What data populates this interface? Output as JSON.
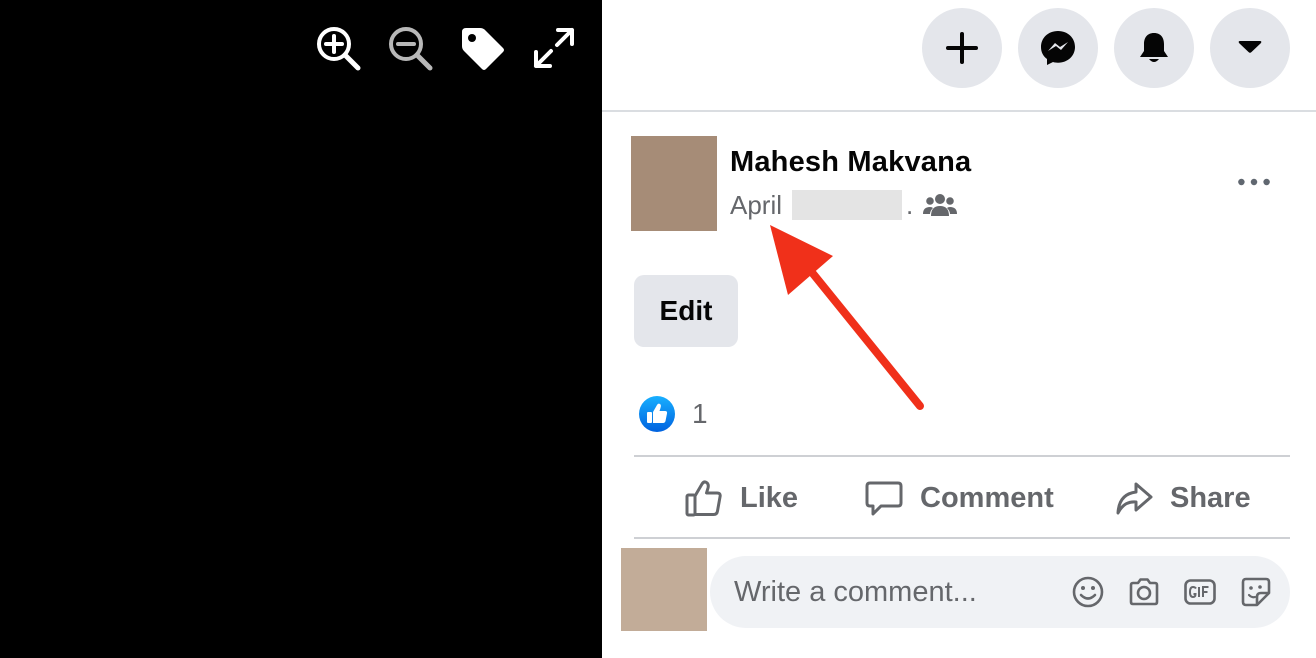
{
  "viewer": {
    "tools": [
      {
        "icon": "zoom-in-icon"
      },
      {
        "icon": "zoom-out-icon"
      },
      {
        "icon": "tag-icon"
      },
      {
        "icon": "fullscreen-icon"
      }
    ]
  },
  "topbar": {
    "buttons": [
      {
        "icon": "plus-icon"
      },
      {
        "icon": "messenger-icon"
      },
      {
        "icon": "bell-icon"
      },
      {
        "icon": "caret-down-icon"
      }
    ]
  },
  "post": {
    "author": "Mahesh Makvana",
    "date_label": "April",
    "separator": ".",
    "audience_icon": "friends-icon",
    "more_icon": "more-horizontal-icon",
    "edit_label": "Edit",
    "reaction_count": "1",
    "reaction_icon": "like-reaction-icon"
  },
  "actions": {
    "like_label": "Like",
    "comment_label": "Comment",
    "share_label": "Share"
  },
  "comment_box": {
    "placeholder": "Write a comment...",
    "icons": [
      "emoji-icon",
      "camera-icon",
      "gif-icon",
      "sticker-icon"
    ]
  },
  "colors": {
    "viewer_bg": "#000000",
    "button_bg": "#e4e6eb",
    "secondary_text": "#65676b",
    "like_blue": "#1877f2",
    "annotation_red": "#f0301a"
  }
}
